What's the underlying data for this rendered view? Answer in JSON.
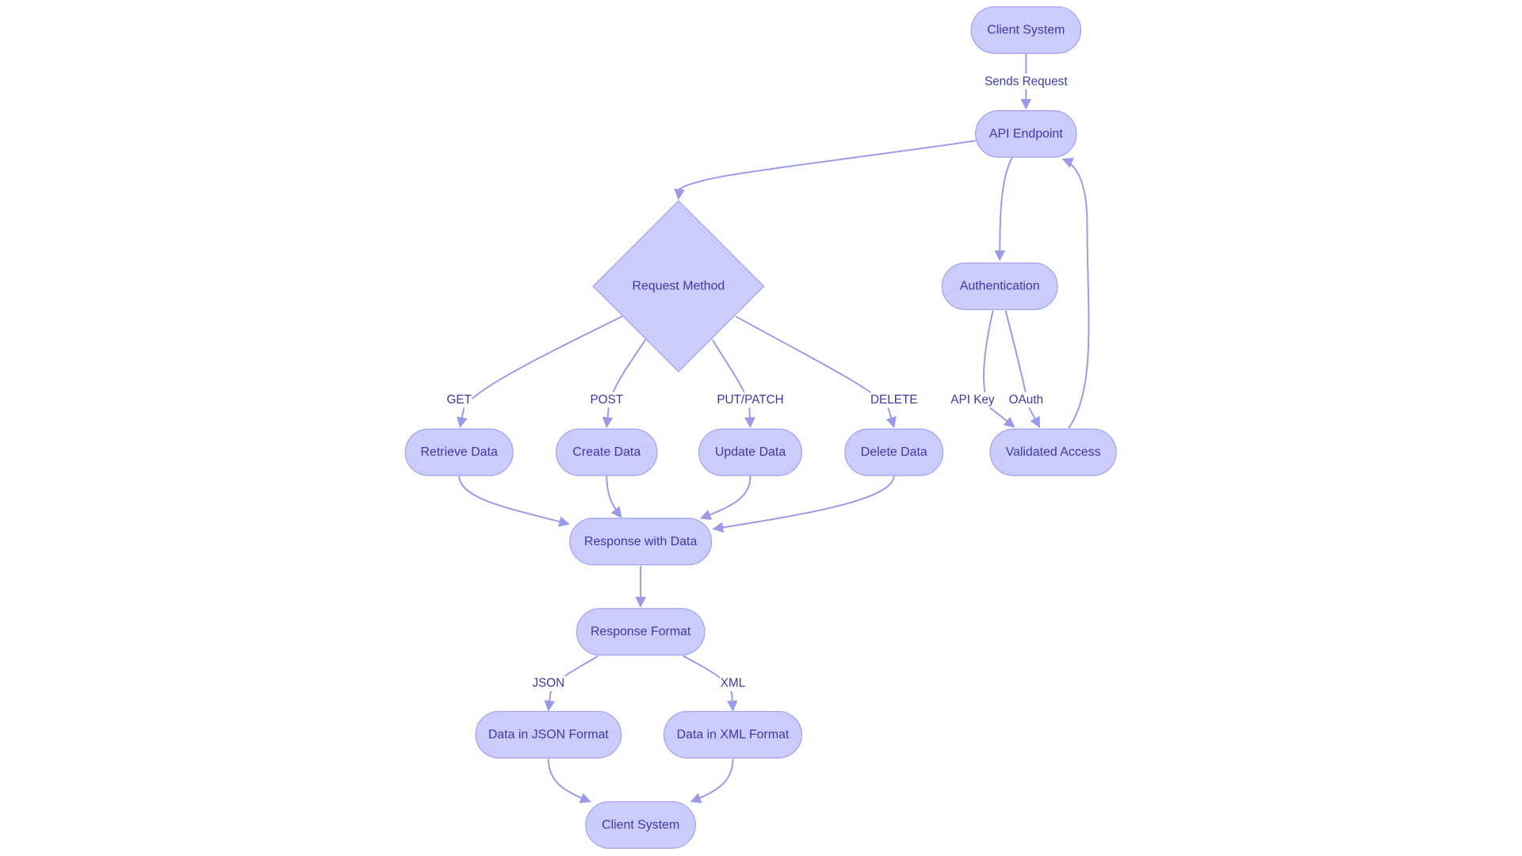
{
  "diagram": {
    "type": "flowchart",
    "colors": {
      "node_fill": "#cbcbfc",
      "node_stroke": "#a3a3ee",
      "edge": "#9a9ae6",
      "text": "#3b3ba3"
    },
    "nodes": [
      {
        "id": "client1",
        "label": "Client System",
        "shape": "rounded"
      },
      {
        "id": "api",
        "label": "API Endpoint",
        "shape": "rounded"
      },
      {
        "id": "method",
        "label": "Request Method",
        "shape": "diamond"
      },
      {
        "id": "auth",
        "label": "Authentication",
        "shape": "rounded"
      },
      {
        "id": "retrieve",
        "label": "Retrieve Data",
        "shape": "rounded"
      },
      {
        "id": "create",
        "label": "Create Data",
        "shape": "rounded"
      },
      {
        "id": "update",
        "label": "Update Data",
        "shape": "rounded"
      },
      {
        "id": "delete",
        "label": "Delete Data",
        "shape": "rounded"
      },
      {
        "id": "validated",
        "label": "Validated Access",
        "shape": "rounded"
      },
      {
        "id": "response",
        "label": "Response with Data",
        "shape": "rounded"
      },
      {
        "id": "format",
        "label": "Response Format",
        "shape": "rounded"
      },
      {
        "id": "json",
        "label": "Data in JSON Format",
        "shape": "rounded"
      },
      {
        "id": "xml",
        "label": "Data in XML Format",
        "shape": "rounded"
      },
      {
        "id": "client2",
        "label": "Client System",
        "shape": "rounded"
      }
    ],
    "edges": [
      {
        "from": "client1",
        "to": "api",
        "label": "Sends Request"
      },
      {
        "from": "api",
        "to": "method",
        "label": ""
      },
      {
        "from": "api",
        "to": "auth",
        "label": ""
      },
      {
        "from": "method",
        "to": "retrieve",
        "label": "GET"
      },
      {
        "from": "method",
        "to": "create",
        "label": "POST"
      },
      {
        "from": "method",
        "to": "update",
        "label": "PUT/PATCH"
      },
      {
        "from": "method",
        "to": "delete",
        "label": "DELETE"
      },
      {
        "from": "auth",
        "to": "validated",
        "label": "API Key"
      },
      {
        "from": "auth",
        "to": "validated",
        "label": "OAuth"
      },
      {
        "from": "validated",
        "to": "api",
        "label": ""
      },
      {
        "from": "retrieve",
        "to": "response",
        "label": ""
      },
      {
        "from": "create",
        "to": "response",
        "label": ""
      },
      {
        "from": "update",
        "to": "response",
        "label": ""
      },
      {
        "from": "delete",
        "to": "response",
        "label": ""
      },
      {
        "from": "response",
        "to": "format",
        "label": ""
      },
      {
        "from": "format",
        "to": "json",
        "label": "JSON"
      },
      {
        "from": "format",
        "to": "xml",
        "label": "XML"
      },
      {
        "from": "json",
        "to": "client2",
        "label": ""
      },
      {
        "from": "xml",
        "to": "client2",
        "label": ""
      }
    ]
  }
}
